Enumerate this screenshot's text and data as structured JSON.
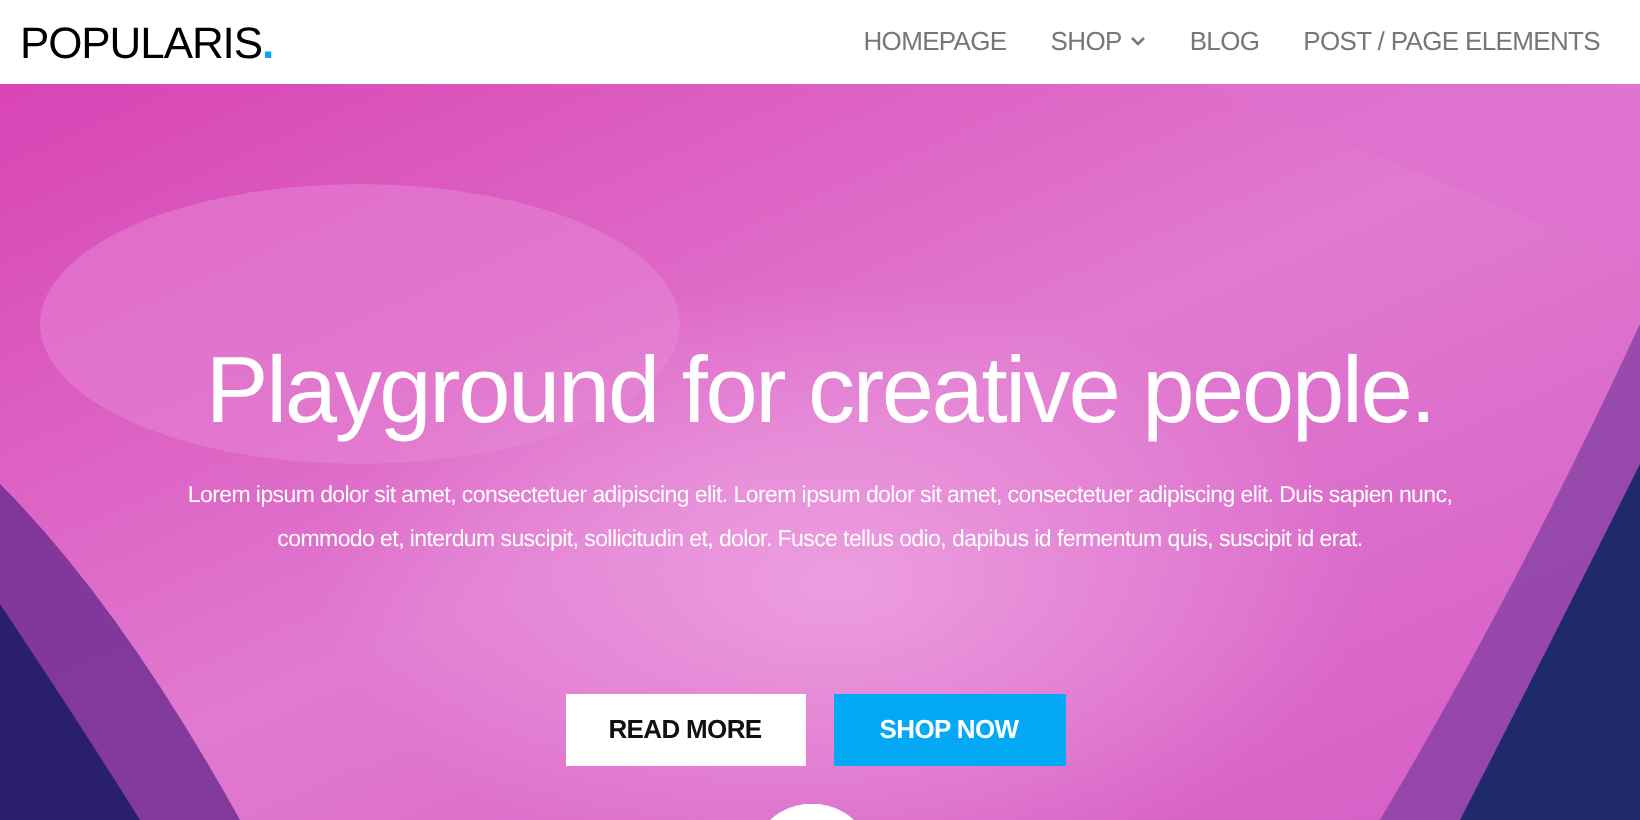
{
  "logo": {
    "text": "POPULARIS",
    "dot": "."
  },
  "nav": [
    {
      "label": "HOMEPAGE",
      "has_submenu": false
    },
    {
      "label": "SHOP",
      "has_submenu": true
    },
    {
      "label": "BLOG",
      "has_submenu": false
    },
    {
      "label": "POST / PAGE ELEMENTS",
      "has_submenu": false
    }
  ],
  "hero": {
    "title": "Playground for creative people.",
    "text": "Lorem ipsum dolor sit amet, consectetuer adipiscing elit. Lorem ipsum dolor sit amet, consectetuer adipiscing elit. Duis sapien nunc, commodo et, interdum suscipit, sollicitudin et, dolor. Fusce tellus odio, dapibus id fermentum quis, suscipit id erat.",
    "buttons": [
      {
        "label": "READ MORE",
        "kind": "light"
      },
      {
        "label": "SHOP NOW",
        "kind": "accent"
      }
    ],
    "scroll_down": true
  }
}
